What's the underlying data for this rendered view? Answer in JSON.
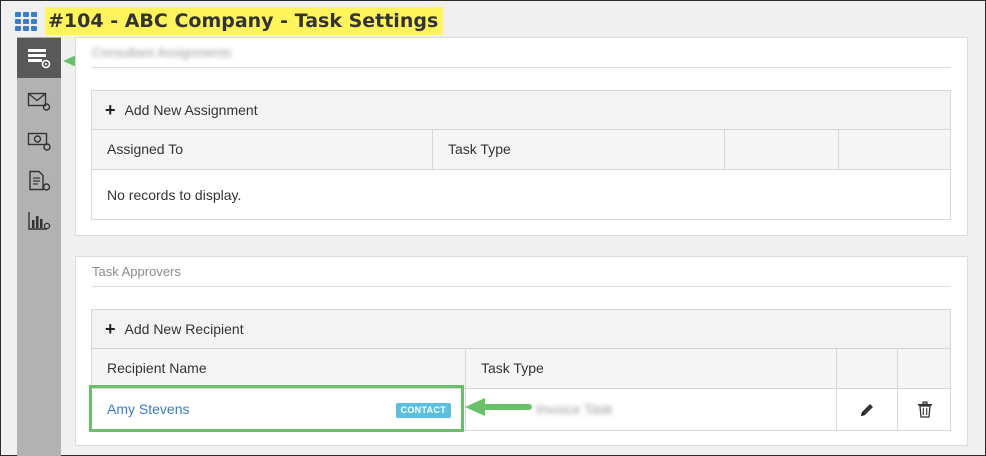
{
  "header": {
    "title": "#104 - ABC Company - Task Settings",
    "icon": "apps-grid-icon"
  },
  "sidebar": {
    "items": [
      {
        "name": "task-settings-icon",
        "active": true
      },
      {
        "name": "email-settings-icon",
        "active": false
      },
      {
        "name": "billing-settings-icon",
        "active": false
      },
      {
        "name": "document-settings-icon",
        "active": false
      },
      {
        "name": "reports-settings-icon",
        "active": false
      }
    ]
  },
  "assignments": {
    "title": "Consultant Assignments",
    "add_label": "Add New Assignment",
    "columns": [
      "Assigned To",
      "Task Type",
      "",
      ""
    ],
    "empty_text": "No records to display."
  },
  "approvers": {
    "title": "Task Approvers",
    "add_label": "Add New Recipient",
    "columns": [
      "Recipient Name",
      "Task Type",
      "",
      ""
    ],
    "rows": [
      {
        "name": "Amy Stevens",
        "badge": "CONTACT",
        "task_type": "Invoice Task"
      }
    ]
  },
  "colors": {
    "highlight": "#fff45c",
    "arrow": "#6abf6a",
    "link": "#3a7cc7",
    "badge": "#5bc0de"
  }
}
